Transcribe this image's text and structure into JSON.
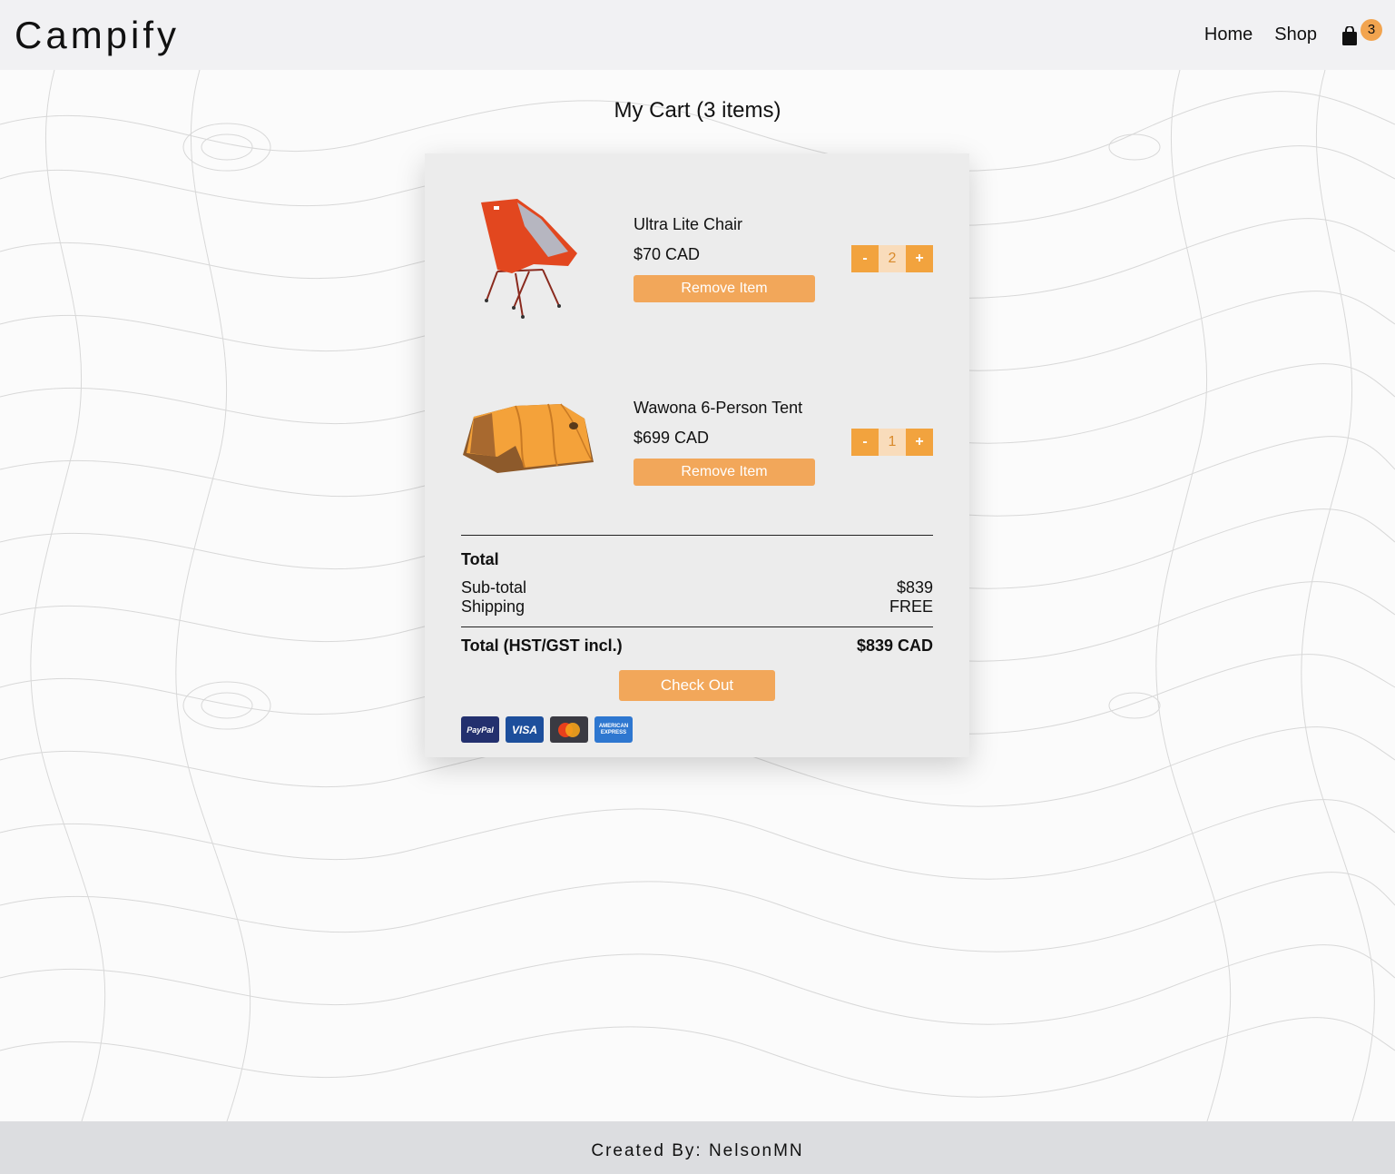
{
  "brand": "Campify",
  "nav": {
    "home": "Home",
    "shop": "Shop",
    "cart_count": "3"
  },
  "page_title": "My Cart (3 items)",
  "items": [
    {
      "name": "Ultra Lite Chair",
      "price": "$70 CAD",
      "remove_label": "Remove Item",
      "quantity": "2",
      "minus": "-",
      "plus": "+"
    },
    {
      "name": "Wawona 6-Person Tent",
      "price": "$699 CAD",
      "remove_label": "Remove Item",
      "quantity": "1",
      "minus": "-",
      "plus": "+"
    }
  ],
  "totals": {
    "heading": "Total",
    "subtotal_label": "Sub-total",
    "subtotal_value": "$839",
    "shipping_label": "Shipping",
    "shipping_value": "FREE",
    "grand_label": "Total (HST/GST incl.)",
    "grand_value": "$839 CAD"
  },
  "checkout_label": "Check Out",
  "payments": {
    "paypal": "PayPal",
    "visa": "VISA",
    "amex_line1": "AMERICAN",
    "amex_line2": "EXPRESS"
  },
  "footer": "Created By: NelsonMN",
  "colors": {
    "accent": "#f2a75a",
    "header_bg": "#f1f1f3",
    "footer_bg": "#dcdde0",
    "card_bg": "#ececec"
  }
}
